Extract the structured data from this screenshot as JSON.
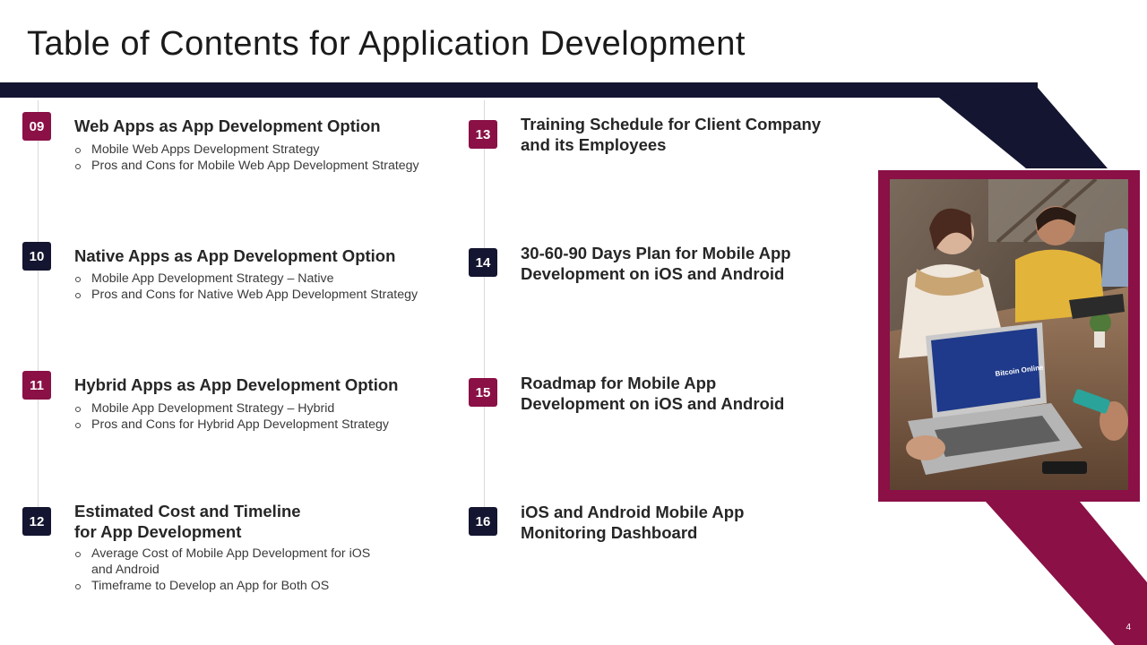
{
  "title": "Table of Contents for Application Development",
  "page_number": "4",
  "colors": {
    "maroon": "#8a1046",
    "navy": "#141530"
  },
  "left_items": [
    {
      "number": "09",
      "heading": "Web Apps as App Development Option",
      "bullets": [
        "Mobile Web Apps Development Strategy",
        "Pros and Cons for Mobile Web App Development Strategy"
      ]
    },
    {
      "number": "10",
      "heading": "Native Apps as App Development Option",
      "bullets": [
        "Mobile App Development Strategy – Native",
        "Pros and Cons for Native Web App Development Strategy"
      ]
    },
    {
      "number": "11",
      "heading": "Hybrid Apps as App Development Option",
      "bullets": [
        "Mobile App Development Strategy – Hybrid",
        "Pros and Cons for Hybrid App Development Strategy"
      ]
    },
    {
      "number": "12",
      "heading_line1": "Estimated Cost and Timeline",
      "heading_line2": "for App Development",
      "bullets_line1a": "Average Cost of Mobile App Development for iOS",
      "bullets_line1b": "and Android",
      "bullets": [
        "Timeframe to Develop an App for Both OS"
      ]
    }
  ],
  "right_items": [
    {
      "number": "13",
      "heading_line1": "Training Schedule for Client Company",
      "heading_line2": "and its Employees"
    },
    {
      "number": "14",
      "heading_line1": "30-60-90 Days Plan for Mobile App",
      "heading_line2": "Development on iOS and Android"
    },
    {
      "number": "15",
      "heading_line1": "Roadmap for Mobile App",
      "heading_line2": "Development on iOS and Android"
    },
    {
      "number": "16",
      "heading_line1": "iOS and Android Mobile App",
      "heading_line2": "Monitoring Dashboard"
    }
  ],
  "photo": {
    "laptop_screen_text": "Bitcoin Online"
  }
}
